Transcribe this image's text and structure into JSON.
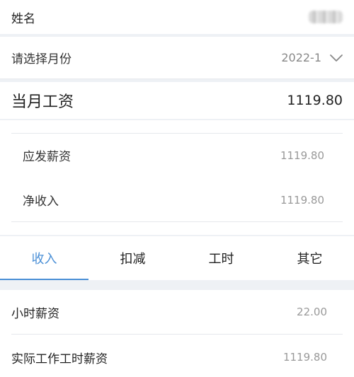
{
  "employee": {
    "name_label": "姓名"
  },
  "month_select": {
    "label": "请选择月份",
    "value": "2022-1"
  },
  "salary": {
    "label": "当月工资",
    "value": "1119.80"
  },
  "details": [
    {
      "label": "应发薪资",
      "value": "1119.80"
    },
    {
      "label": "净收入",
      "value": "1119.80"
    }
  ],
  "tabs": [
    {
      "label": "收入",
      "active": true
    },
    {
      "label": "扣减",
      "active": false
    },
    {
      "label": "工时",
      "active": false
    },
    {
      "label": "其它",
      "active": false
    }
  ],
  "income_items": [
    {
      "label": "小时薪资",
      "value": "22.00"
    },
    {
      "label": "实际工作工时薪资",
      "value": "1119.80"
    }
  ],
  "colors": {
    "accent": "#4a8fd6",
    "background": "#eef1f5"
  },
  "icons": {
    "month_picker": "chevron-down-icon"
  }
}
